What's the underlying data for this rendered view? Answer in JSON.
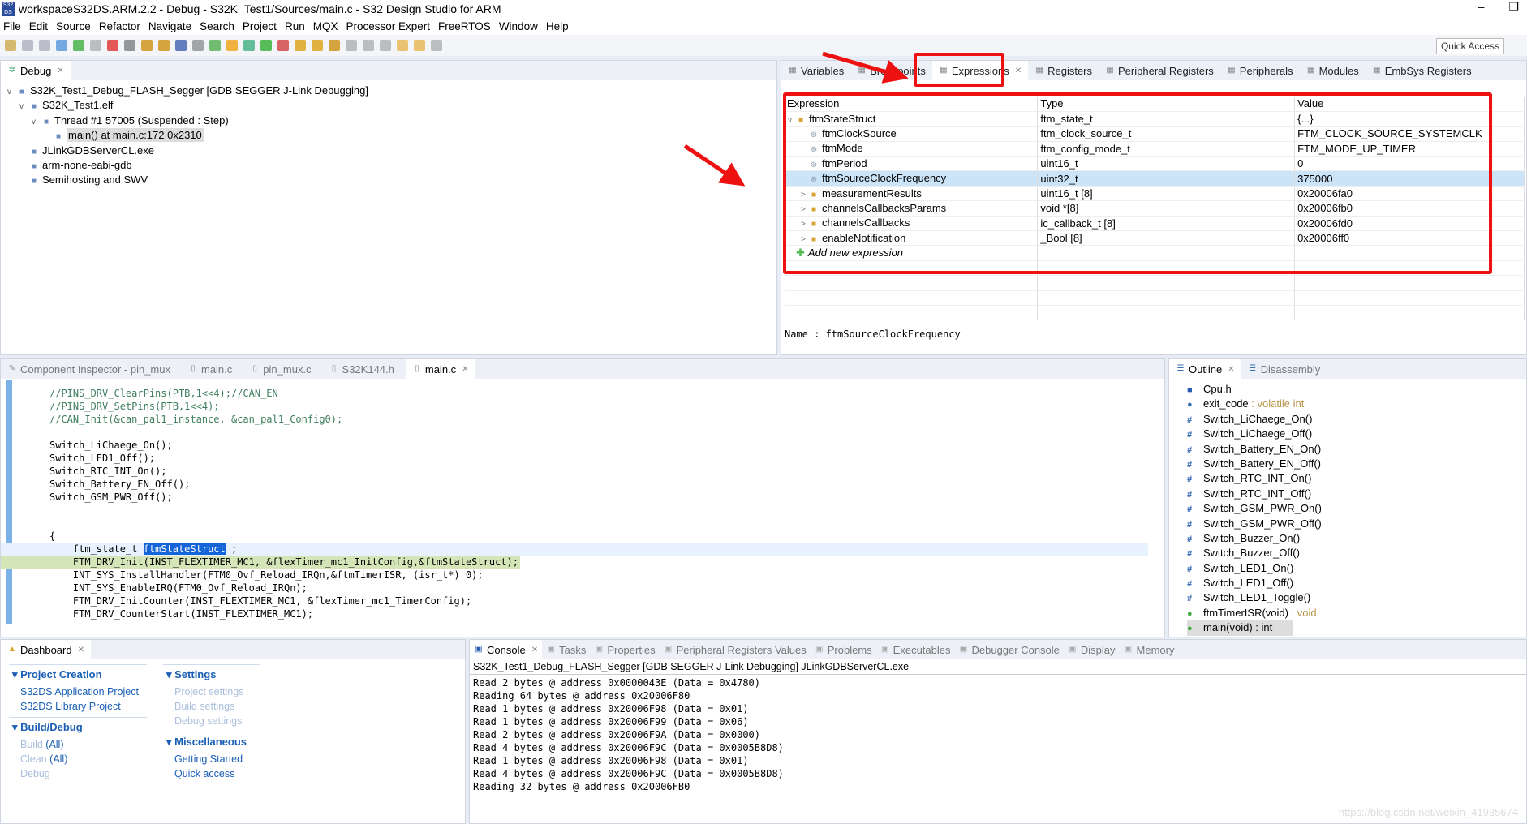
{
  "window": {
    "title": "workspaceS32DS.ARM.2.2 - Debug - S32K_Test1/Sources/main.c - S32 Design Studio for ARM",
    "logo": "S32 DS"
  },
  "menu": [
    "File",
    "Edit",
    "Source",
    "Refactor",
    "Navigate",
    "Search",
    "Project",
    "Run",
    "MQX",
    "Processor Expert",
    "FreeRTOS",
    "Window",
    "Help"
  ],
  "toolbar": {
    "quick_access": "Quick Access"
  },
  "debug": {
    "tab": "Debug",
    "tree": [
      {
        "label": "S32K_Test1_Debug_FLASH_Segger [GDB SEGGER J-Link Debugging]",
        "indent": 0,
        "toggle": "v",
        "icon": "launch-icon"
      },
      {
        "label": "S32K_Test1.elf",
        "indent": 1,
        "toggle": "v",
        "icon": "process-icon"
      },
      {
        "label": "Thread #1 57005 (Suspended : Step)",
        "indent": 2,
        "toggle": "v",
        "icon": "thread-icon"
      },
      {
        "label": "main() at main.c:172 0x2310",
        "indent": 3,
        "toggle": "",
        "icon": "stack-frame-icon",
        "selected": true
      },
      {
        "label": "JLinkGDBServerCL.exe",
        "indent": 1,
        "toggle": "",
        "icon": "process-icon"
      },
      {
        "label": "arm-none-eabi-gdb",
        "indent": 1,
        "toggle": "",
        "icon": "process-icon"
      },
      {
        "label": "Semihosting and SWV",
        "indent": 1,
        "toggle": "",
        "icon": "process-icon"
      }
    ]
  },
  "right": {
    "tabs": [
      "Variables",
      "Breakpoints",
      "Expressions",
      "Registers",
      "Peripheral Registers",
      "Peripherals",
      "Modules",
      "EmbSys Registers"
    ],
    "active": 2,
    "columns": [
      "Expression",
      "Type",
      "Value"
    ],
    "rows": [
      {
        "name": "ftmStateStruct",
        "type": "ftm_state_t",
        "value": "{...}",
        "toggle": "v",
        "indent": 0
      },
      {
        "name": "ftmClockSource",
        "type": "ftm_clock_source_t",
        "value": "FTM_CLOCK_SOURCE_SYSTEMCLK",
        "toggle": "",
        "indent": 1
      },
      {
        "name": "ftmMode",
        "type": "ftm_config_mode_t",
        "value": "FTM_MODE_UP_TIMER",
        "toggle": "",
        "indent": 1
      },
      {
        "name": "ftmPeriod",
        "type": "uint16_t",
        "value": "0",
        "toggle": "",
        "indent": 1
      },
      {
        "name": "ftmSourceClockFrequency",
        "type": "uint32_t",
        "value": "375000",
        "toggle": "",
        "indent": 1,
        "selected": true
      },
      {
        "name": "measurementResults",
        "type": "uint16_t [8]",
        "value": "0x20006fa0",
        "toggle": ">",
        "indent": 1
      },
      {
        "name": "channelsCallbacksParams",
        "type": "void *[8]",
        "value": "0x20006fb0",
        "toggle": ">",
        "indent": 1
      },
      {
        "name": "channelsCallbacks",
        "type": "ic_callback_t [8]",
        "value": "0x20006fd0",
        "toggle": ">",
        "indent": 1
      },
      {
        "name": "enableNotification",
        "type": "_Bool [8]",
        "value": "0x20006ff0",
        "toggle": ">",
        "indent": 1
      }
    ],
    "add_expression": "Add new expression",
    "detail": "Name : ftmSourceClockFrequency"
  },
  "editor": {
    "tabs": [
      "Component Inspector - pin_mux",
      "main.c",
      "pin_mux.c",
      "S32K144.h",
      "main.c"
    ],
    "active": 4,
    "lines": [
      {
        "text": "//PINS_DRV_ClearPins(PTB,1<<4);//CAN_EN",
        "cls": "cm"
      },
      {
        "text": "//PINS_DRV_SetPins(PTB,1<<4);",
        "cls": "cm"
      },
      {
        "text": "//CAN_Init(&can_pal1_instance, &can_pal1_Config0);",
        "cls": "cm"
      },
      {
        "text": ""
      },
      {
        "text": "Switch_LiChaege_On();"
      },
      {
        "text": "Switch_LED1_Off();"
      },
      {
        "text": "Switch_RTC_INT_On();"
      },
      {
        "text": "Switch_Battery_EN_Off();"
      },
      {
        "text": "Switch_GSM_PWR_Off();"
      },
      {
        "text": ""
      },
      {
        "text": ""
      },
      {
        "text": "{"
      },
      {
        "text": "    ftm_state_t ftmStateStruct ;",
        "cls": "cur"
      },
      {
        "text": "    FTM_DRV_Init(INST_FLEXTIMER_MC1, &flexTimer_mc1_InitConfig,&ftmStateStruct);",
        "cls": "hl"
      },
      {
        "text": "    INT_SYS_InstallHandler(FTM0_Ovf_Reload_IRQn,&ftmTimerISR, (isr_t*) 0);"
      },
      {
        "text": "    INT_SYS_EnableIRQ(FTM0_Ovf_Reload_IRQn);"
      },
      {
        "text": "    FTM_DRV_InitCounter(INST_FLEXTIMER_MC1, &flexTimer_mc1_TimerConfig);"
      },
      {
        "text": "    FTM_DRV_CounterStart(INST_FLEXTIMER_MC1);"
      }
    ]
  },
  "outline": {
    "tabs": [
      "Outline",
      "Disassembly"
    ],
    "items": [
      {
        "name": "Cpu.h",
        "suffix": "",
        "icon": "include-icon"
      },
      {
        "name": "exit_code",
        "suffix": " : volatile int",
        "icon": "variable-icon"
      },
      {
        "name": "Switch_LiChaege_On()",
        "suffix": "",
        "icon": "macro-icon"
      },
      {
        "name": "Switch_LiChaege_Off()",
        "suffix": "",
        "icon": "macro-icon"
      },
      {
        "name": "Switch_Battery_EN_On()",
        "suffix": "",
        "icon": "macro-icon"
      },
      {
        "name": "Switch_Battery_EN_Off()",
        "suffix": "",
        "icon": "macro-icon"
      },
      {
        "name": "Switch_RTC_INT_On()",
        "suffix": "",
        "icon": "macro-icon"
      },
      {
        "name": "Switch_RTC_INT_Off()",
        "suffix": "",
        "icon": "macro-icon"
      },
      {
        "name": "Switch_GSM_PWR_On()",
        "suffix": "",
        "icon": "macro-icon"
      },
      {
        "name": "Switch_GSM_PWR_Off()",
        "suffix": "",
        "icon": "macro-icon"
      },
      {
        "name": "Switch_Buzzer_On()",
        "suffix": "",
        "icon": "macro-icon"
      },
      {
        "name": "Switch_Buzzer_Off()",
        "suffix": "",
        "icon": "macro-icon"
      },
      {
        "name": "Switch_LED1_On()",
        "suffix": "",
        "icon": "macro-icon"
      },
      {
        "name": "Switch_LED1_Off()",
        "suffix": "",
        "icon": "macro-icon"
      },
      {
        "name": "Switch_LED1_Toggle()",
        "suffix": "",
        "icon": "macro-icon"
      },
      {
        "name": "ftmTimerISR(void)",
        "suffix": " : void",
        "icon": "function-icon"
      },
      {
        "name": "main(void) : int",
        "suffix": "",
        "icon": "function-icon",
        "selected": true
      }
    ]
  },
  "dashboard": {
    "tab": "Dashboard",
    "project_creation": "Project Creation",
    "s32ds_app": "S32DS Application Project",
    "s32ds_lib": "S32DS Library Project",
    "build_debug": "Build/Debug",
    "build": "Build",
    "clean": "Clean",
    "all": "(All)",
    "debug": "Debug",
    "settings": "Settings",
    "project_settings": "Project settings",
    "build_settings": "Build settings",
    "debug_settings": "Debug settings",
    "misc": "Miscellaneous",
    "getting_started": "Getting Started",
    "quick_access": "Quick access"
  },
  "console": {
    "tabs": [
      "Console",
      "Tasks",
      "Properties",
      "Peripheral Registers Values",
      "Problems",
      "Executables",
      "Debugger Console",
      "Display",
      "Memory"
    ],
    "header": "S32K_Test1_Debug_FLASH_Segger [GDB SEGGER J-Link Debugging] JLinkGDBServerCL.exe",
    "lines": [
      "Read 2 bytes @ address 0x0000043E (Data = 0x4780)",
      "Reading 64 bytes @ address 0x20006F80",
      "Read 1 bytes @ address 0x20006F98 (Data = 0x01)",
      "Read 1 bytes @ address 0x20006F99 (Data = 0x06)",
      "Read 2 bytes @ address 0x20006F9A (Data = 0x0000)",
      "Read 4 bytes @ address 0x20006F9C (Data = 0x0005B8D8)",
      "Read 1 bytes @ address 0x20006F98 (Data = 0x01)",
      "Read 4 bytes @ address 0x20006F9C (Data = 0x0005B8D8)",
      "Reading 32 bytes @ address 0x20006FB0"
    ]
  },
  "watermark": "https://blog.csdn.net/weixin_41935674",
  "colors": {
    "annotation": "#ee1111",
    "selection": "#cce4f7",
    "current_line": "#d4e6b8"
  }
}
